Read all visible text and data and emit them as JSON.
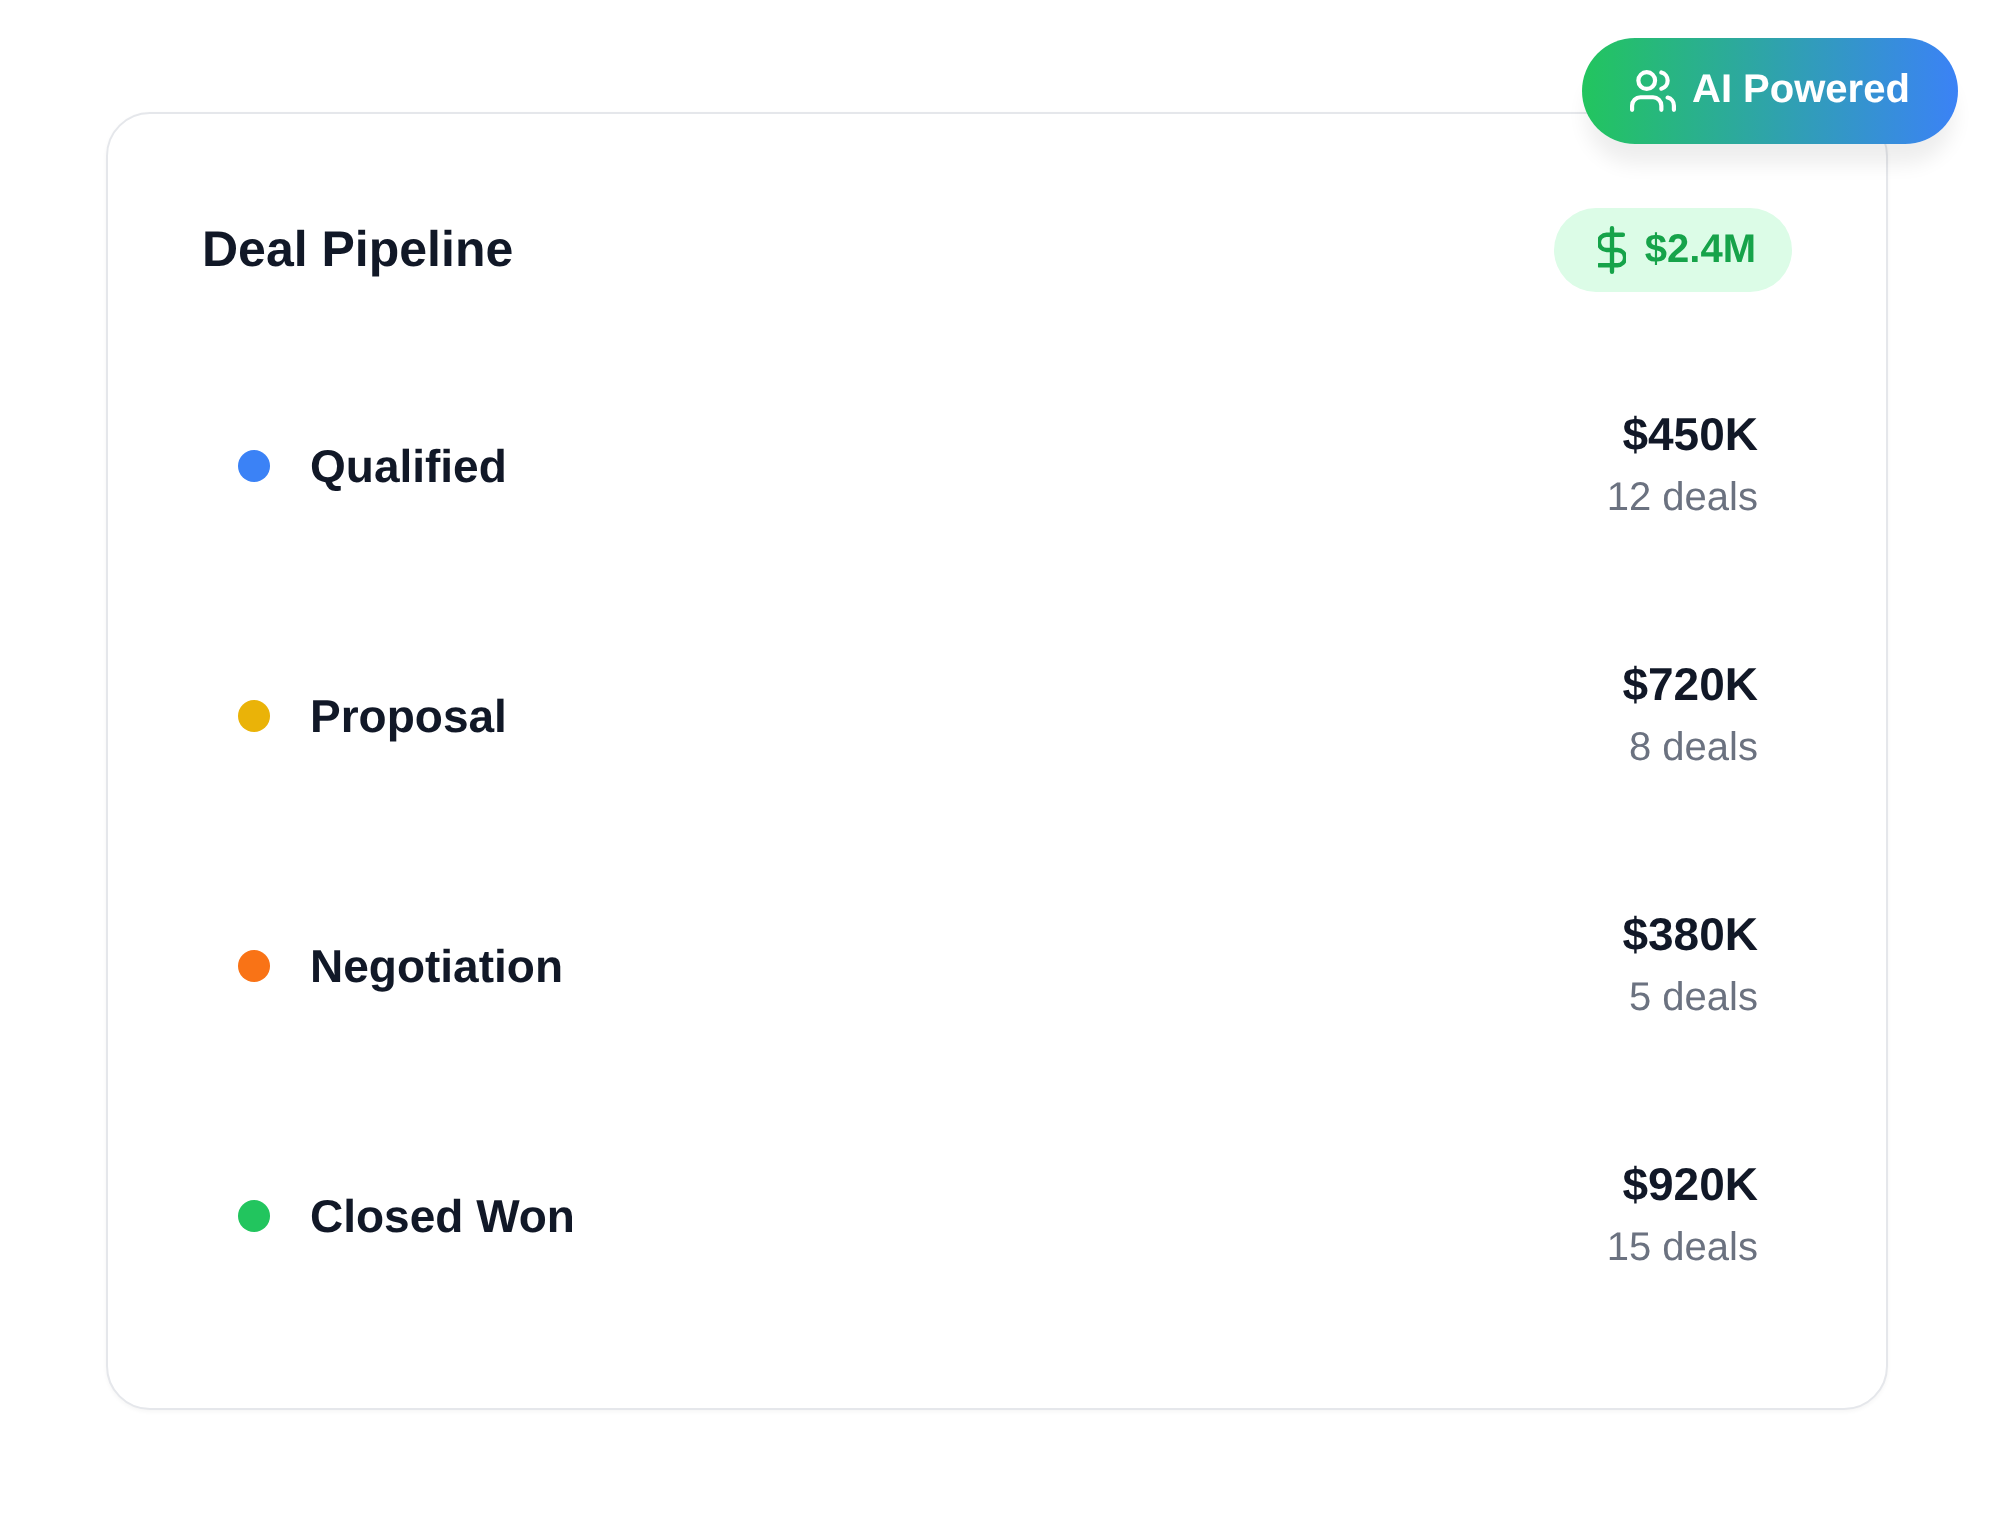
{
  "tag": {
    "label": "AI Powered"
  },
  "card": {
    "title": "Deal Pipeline",
    "total": "$2.4M",
    "stages": [
      {
        "name": "Qualified",
        "color": "#3b82f6",
        "value": "$450K",
        "deals": "12 deals"
      },
      {
        "name": "Proposal",
        "color": "#eab308",
        "value": "$720K",
        "deals": "8 deals"
      },
      {
        "name": "Negotiation",
        "color": "#f97316",
        "value": "$380K",
        "deals": "5 deals"
      },
      {
        "name": "Closed Won",
        "color": "#22c55e",
        "value": "$920K",
        "deals": "15 deals"
      }
    ]
  }
}
